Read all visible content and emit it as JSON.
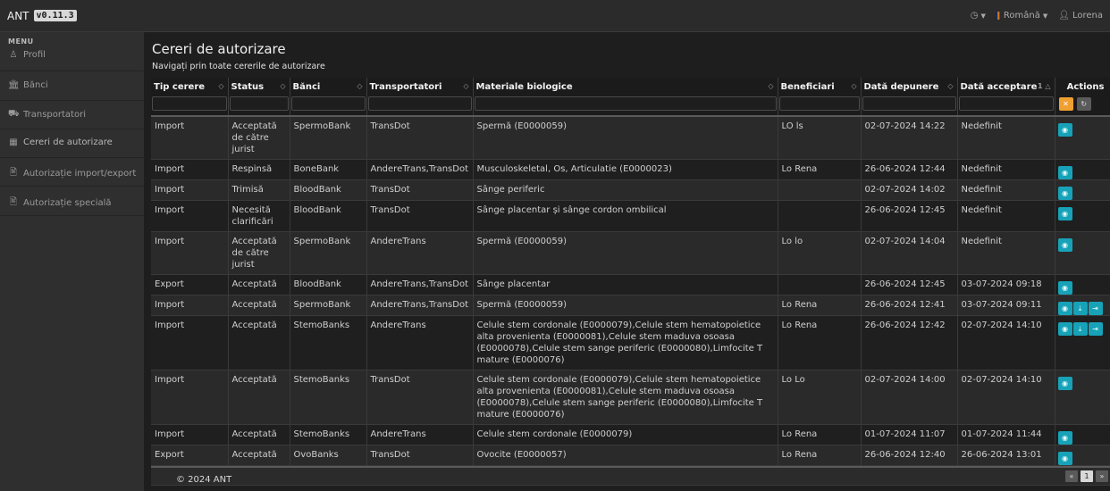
{
  "app": {
    "name": "ANT",
    "version": "v0.11.3"
  },
  "topbar": {
    "clock_icon": "clock-icon",
    "language": "Română",
    "user": "Lorena"
  },
  "sidebar": {
    "menu_label": "MENU",
    "items": [
      {
        "label": "Profil",
        "icon": "user-icon"
      },
      {
        "label": "Bănci",
        "icon": "bank-icon"
      },
      {
        "label": "Transportatori",
        "icon": "truck-icon"
      },
      {
        "label": "Cereri de autorizare",
        "icon": "table-icon"
      },
      {
        "label": "Autorizație import/export",
        "icon": "document-icon"
      },
      {
        "label": "Autorizație specială",
        "icon": "document-icon"
      }
    ]
  },
  "page": {
    "title": "Cereri de autorizare",
    "subtitle": "Navigați prin toate cererile de autorizare"
  },
  "table": {
    "columns": [
      "Tip cerere",
      "Status",
      "Bănci",
      "Transportatori",
      "Materiale biologice",
      "Beneficiari",
      "Dată depunere",
      "Dată acceptare",
      "Actions"
    ],
    "rows": [
      {
        "tip": "Import",
        "status": "Acceptată de către jurist",
        "banci": "SpermoBank",
        "transportatori": "TransDot",
        "materiale": "Spermă (E0000059)",
        "beneficiari": "LO ls",
        "depunere": "02-07-2024 14:22",
        "acceptare": "Nedefinit",
        "actions": 1
      },
      {
        "tip": "Import",
        "status": "Respinsă",
        "banci": "BoneBank",
        "transportatori": "AndereTrans,TransDot",
        "materiale": "Musculoskeletal, Os, Articulatie (E0000023)",
        "beneficiari": "Lo Rena",
        "depunere": "26-06-2024 12:44",
        "acceptare": "Nedefinit",
        "actions": 1
      },
      {
        "tip": "Import",
        "status": "Trimisă",
        "banci": "BloodBank",
        "transportatori": "TransDot",
        "materiale": "Sânge periferic",
        "beneficiari": "",
        "depunere": "02-07-2024 14:02",
        "acceptare": "Nedefinit",
        "actions": 1
      },
      {
        "tip": "Import",
        "status": "Necesită clarificări",
        "banci": "BloodBank",
        "transportatori": "TransDot",
        "materiale": "Sânge placentar și sânge cordon ombilical",
        "beneficiari": "",
        "depunere": "26-06-2024 12:45",
        "acceptare": "Nedefinit",
        "actions": 1
      },
      {
        "tip": "Import",
        "status": "Acceptată de către jurist",
        "banci": "SpermoBank",
        "transportatori": "AndereTrans",
        "materiale": "Spermă (E0000059)",
        "beneficiari": "Lo lo",
        "depunere": "02-07-2024 14:04",
        "acceptare": "Nedefinit",
        "actions": 1
      },
      {
        "tip": "Export",
        "status": "Acceptată",
        "banci": "BloodBank",
        "transportatori": "AndereTrans,TransDot",
        "materiale": "Sânge placentar",
        "beneficiari": "",
        "depunere": "26-06-2024 12:45",
        "acceptare": "03-07-2024 09:18",
        "actions": 1
      },
      {
        "tip": "Import",
        "status": "Acceptată",
        "banci": "SpermoBank",
        "transportatori": "AndereTrans,TransDot",
        "materiale": "Spermă (E0000059)",
        "beneficiari": "Lo Rena",
        "depunere": "26-06-2024 12:41",
        "acceptare": "03-07-2024 09:11",
        "actions": 3
      },
      {
        "tip": "Import",
        "status": "Acceptată",
        "banci": "StemoBanks",
        "transportatori": "AndereTrans",
        "materiale": "Celule stem cordonale (E0000079),Celule stem hematopoietice alta provenienta (E0000081),Celule stem maduva osoasa (E0000078),Celule stem sange periferic (E0000080),Limfocite T mature (E0000076)",
        "beneficiari": "Lo Rena",
        "depunere": "26-06-2024 12:42",
        "acceptare": "02-07-2024 14:10",
        "actions": 3
      },
      {
        "tip": "Import",
        "status": "Acceptată",
        "banci": "StemoBanks",
        "transportatori": "TransDot",
        "materiale": "Celule stem cordonale (E0000079),Celule stem hematopoietice alta provenienta (E0000081),Celule stem maduva osoasa (E0000078),Celule stem sange periferic (E0000080),Limfocite T mature (E0000076)",
        "beneficiari": "Lo Lo",
        "depunere": "02-07-2024 14:00",
        "acceptare": "02-07-2024 14:10",
        "actions": 1
      },
      {
        "tip": "Import",
        "status": "Acceptată",
        "banci": "StemoBanks",
        "transportatori": "AndereTrans",
        "materiale": "Celule stem cordonale (E0000079)",
        "beneficiari": "Lo Rena",
        "depunere": "01-07-2024 11:07",
        "acceptare": "01-07-2024 11:44",
        "actions": 1
      },
      {
        "tip": "Export",
        "status": "Acceptată",
        "banci": "OvoBanks",
        "transportatori": "TransDot",
        "materiale": "Ovocite (E0000057)",
        "beneficiari": "Lo Rena",
        "depunere": "26-06-2024 12:40",
        "acceptare": "26-06-2024 13:01",
        "actions": 1
      }
    ]
  },
  "pagination": {
    "current_page": "1",
    "prev": "«",
    "next": "»"
  },
  "footer": {
    "copyright": "© 2024 ANT"
  },
  "colors": {
    "accent": "#17a2b8",
    "clear_filter": "#f0a030"
  }
}
